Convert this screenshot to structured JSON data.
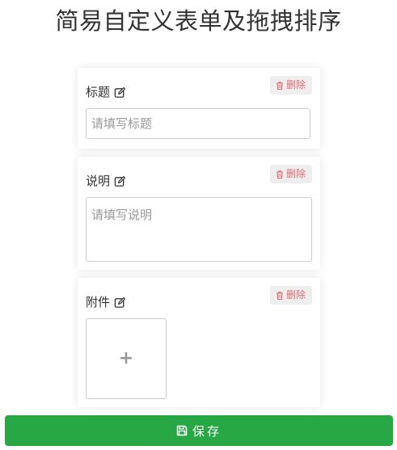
{
  "page": {
    "title": "简易自定义表单及拖拽排序"
  },
  "colors": {
    "accent_green": "#28a745",
    "delete_text": "#e06c75",
    "delete_bg": "#eeeeee",
    "border": "#cccccc",
    "placeholder": "#999999"
  },
  "fields": [
    {
      "label": "标题",
      "type": "text",
      "placeholder": "请填写标题",
      "value": "",
      "delete_label": "删除",
      "edit_icon": "edit-icon",
      "delete_icon": "trash-icon"
    },
    {
      "label": "说明",
      "type": "textarea",
      "placeholder": "请填写说明",
      "value": "",
      "delete_label": "删除",
      "edit_icon": "edit-icon",
      "delete_icon": "trash-icon"
    },
    {
      "label": "附件",
      "type": "upload",
      "upload_symbol": "+",
      "delete_label": "删除",
      "edit_icon": "edit-icon",
      "delete_icon": "trash-icon"
    }
  ],
  "footer": {
    "save_label": "保存",
    "save_icon": "floppy-disk-icon"
  }
}
